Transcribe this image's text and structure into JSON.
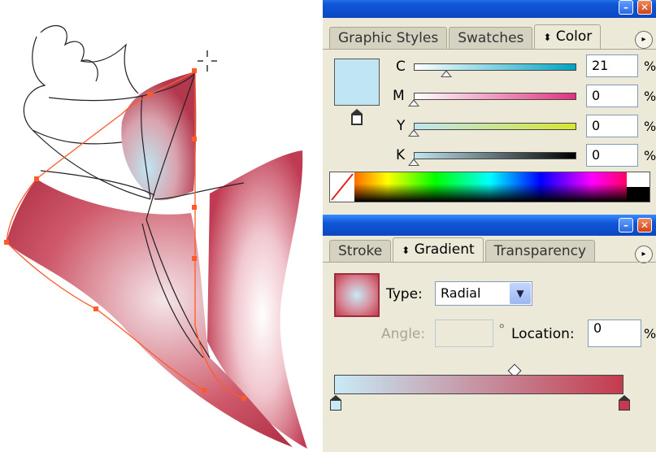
{
  "color_panel": {
    "tabs": [
      "Graphic Styles",
      "Swatches",
      "Color"
    ],
    "active_tab_prefix": "⬍",
    "fill_color": "#bfe6f2",
    "channels": [
      {
        "label": "C",
        "value": "21",
        "percent": "%",
        "fraction": 0.21
      },
      {
        "label": "M",
        "value": "0",
        "percent": "%",
        "fraction": 0
      },
      {
        "label": "Y",
        "value": "0",
        "percent": "%",
        "fraction": 0
      },
      {
        "label": "K",
        "value": "0",
        "percent": "%",
        "fraction": 0
      }
    ]
  },
  "gradient_panel": {
    "tabs": [
      "Stroke",
      "Gradient",
      "Transparency"
    ],
    "active_tab_prefix": "⬍",
    "type_label": "Type:",
    "type_value": "Radial",
    "angle_label": "Angle:",
    "angle_value": "",
    "degree_symbol": "°",
    "location_label": "Location:",
    "location_value": "0",
    "location_percent": "%",
    "start_color": "#c8eaf7",
    "end_color": "#c43b4d"
  },
  "icons": {
    "panel_menu": "▸",
    "minimize": "–",
    "close": "✕",
    "dropdown": "▼"
  }
}
